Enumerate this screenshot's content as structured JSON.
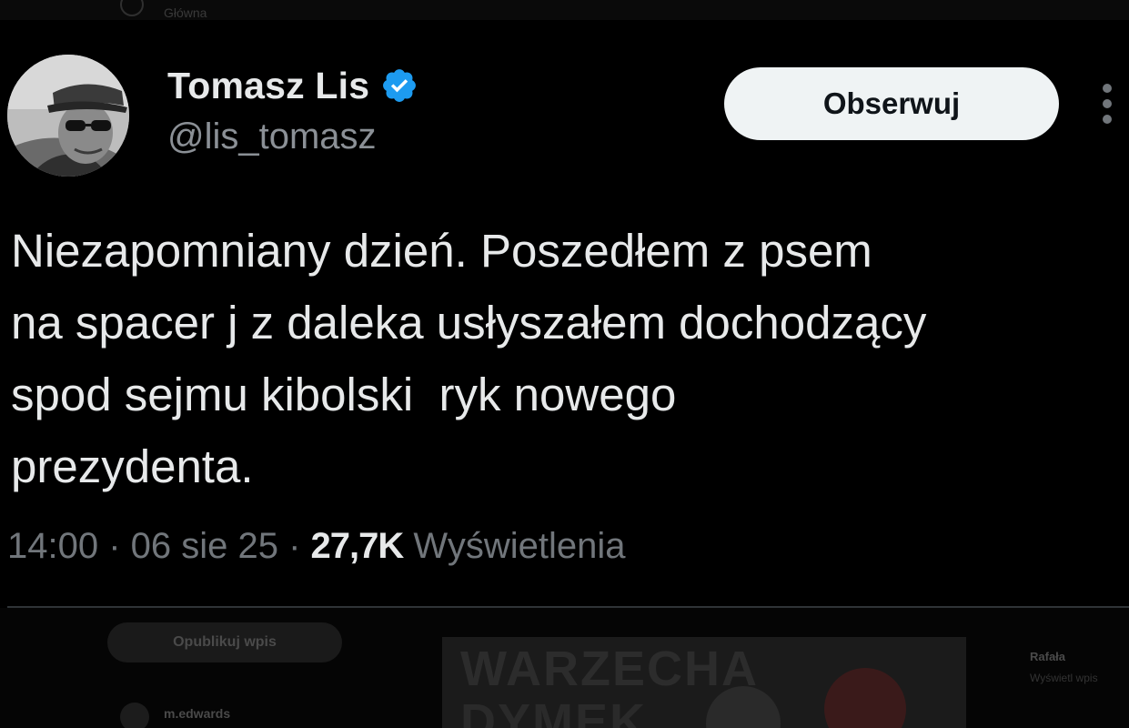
{
  "top_bar": {
    "faint_text": "Główna"
  },
  "author": {
    "display_name": "Tomasz Lis",
    "handle": "@lis_tomasz",
    "verified": true,
    "avatar_icon": "profile-photo-man-in-cap"
  },
  "actions": {
    "follow_label": "Obserwuj",
    "more_icon": "more-vertical-icon"
  },
  "tweet": {
    "text": "Niezapomniany dzień. Poszedłem z psem\nna spacer j z daleka usłyszałem dochodzący\nspod sejmu kibolski  ryk nowego\nprezydenta.",
    "time": "14:00",
    "date": "06 sie 25",
    "separator": " · ",
    "views_count": "27,7K",
    "views_label": "Wyświetlenia"
  },
  "background_feed": {
    "reply_button_label": "Opublikuj wpis",
    "user_handle": "m.edwards",
    "image_text_line1": "WARZECHA",
    "image_text_line2": "DYMEK",
    "side_title": "Rafała",
    "side_subtitle": "Wyświetl wpis"
  },
  "colors": {
    "background": "#000000",
    "primary_text": "#e7e9ea",
    "secondary_text": "#71767b",
    "verified_blue": "#1d9bf0",
    "follow_button_bg": "#eff3f4",
    "divider": "#2f3336"
  }
}
